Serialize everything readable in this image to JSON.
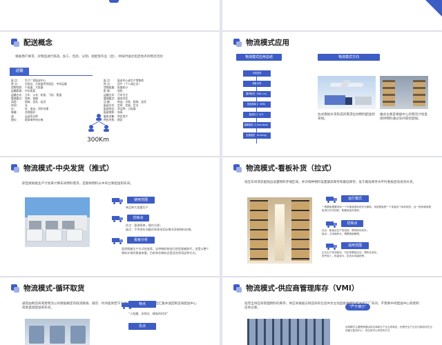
{
  "colors": {
    "accent": "#3d5cc4",
    "accent_light": "#9fb0e6",
    "bg": "#e4e7ee"
  },
  "s1": {
    "title": "配送概念",
    "intro": "根据用户要求，对物品进行拣选、加工、包装、分割、组配等作业（后），并按时送达指定地点的物流活动",
    "label": "运输",
    "rows_left": [
      [
        "起 点：",
        "生产厂家配送中心"
      ],
      [
        "终 点：",
        "分网点、大批量供货园区、中间运输"
      ],
      [
        "货物性质：",
        "少批量、大批量"
      ],
      [
        "运输距离：",
        "中长距离"
      ],
      [
        "运输方式：",
        "大车、火车、轮船、飞机、管道"
      ],
      [
        "管理要点：",
        "简单、快捷"
      ],
      [
        "风险：",
        "损耗、丢失、延迟"
      ],
      [
        "时间：",
        "长"
      ],
      [
        "分：",
        "优、变动，同步处理"
      ],
      [
        "装载：",
        "合理组织"
      ],
      [
        "送：",
        "运送多品种"
      ],
      [
        "提价：",
        "提高每件的价格"
      ]
    ],
    "rows_right": [
      [
        "起 点：",
        "配送中心或生产零售商"
      ],
      [
        "终 点：",
        "用户（个人或企业）"
      ],
      [
        "货物批量：",
        "批量较小"
      ],
      [
        "距 离：",
        "较短"
      ],
      [
        "运输方式：",
        "汽车为主"
      ],
      [
        "管理要点：",
        "服务优先"
      ],
      [
        "功 能：",
        "拣选、分拣、配装、送货"
      ],
      [
        "配送方式：",
        "定时、定量、定点"
      ],
      [
        "配送特点：",
        "多品种、小批量"
      ],
      [
        "配送频率：",
        "较高"
      ],
      [
        "服务对象：",
        "特定用户"
      ],
      [
        "供应关系：",
        "稳定"
      ]
    ],
    "distance": "300Km",
    "people_icon": "people-network-icon"
  },
  "s2": {
    "title": "物流模式应用",
    "tab1": "物流模式应用总结",
    "tab2": "物流模式方向",
    "flow": [
      "中央发货",
      "看板补货",
      "循环取货（Milk run）",
      "供应商库存（VMI）",
      "直送补货（JIT）",
      "越库配送（Cross-dock）",
      "定量配送（Arriving）"
    ],
    "cap1": "拉式看板补货形成的需求拉动物料配送到货线。",
    "cap2": "推式主要是根据中心的物流计划直接将物料通过车间或装配线。"
  },
  "s3": {
    "title": "物流模式-中央发货（推式）",
    "intro": "即直接根据生产计划来计算车间物料需求，定期将物料从中央仓库配送到车间。",
    "tag1": "使用范围",
    "t1": "单品种大批量生产",
    "tag2": "优缺点",
    "t2": "优点：管理简单，操作方便；\n缺点：不考虑车间缓存和现场实际情况导致物料存储。",
    "tag3": "看板分析",
    "t3": "虽然随着生产方式的变革，这种物料物流已经逐渐被取代，但是从整个物料计划的角度来看，目前有些物料还是适合采用这种方式。"
  },
  "s4": {
    "title": "物流模式-看板补货（拉式）",
    "intro": "指在车间或装配线边设置物料存储区域，并对每种物料设置最高库存和最低库存，低于最低库存水平时看板启动发货补货。",
    "tag1": "运行模式",
    "t1": "一般看板需要采用一个平衡制造系统作为基础，传统看板是一个或者多个库存相关，且一般地使用看板进行补货控制，配套相连的库房，",
    "tag2": "优缺点",
    "t2": "优点：能保证生产的连续，降低库存成本；\n缺点：占用面积大，需要精细管理。",
    "tag3": "适用范围",
    "t3": "企业生产线流程化，可实现看板拉动，物料标准化；\n型号较少，批量较大，如流水线装配等。"
  },
  "s5": {
    "title": "物流模式-循环取货",
    "intro": "通常由制造商或者物流公司根据确定的取货路线、顺次、时间驱到若干个供应商处依次取货，最后汇集并送回制造商配送中心或者直接配送到车间。",
    "tag1": "特点",
    "t1": "“小批量、多频次、精准的时间”",
    "tag2": "优点"
  },
  "s6": {
    "title": "物流模式-供应商管理库存（VMI）",
    "intro": "指完全供应商管理物料的库存，供应商根据与制造商的信息共享主动直接将物料配送到工厂车间，不需要中间配送中心或者制造商仓库。",
    "bubble": "“严于律己”",
    "t1": "这种模式主要是根据由供应商和生产企业来制定，但是在生产企业内部如何在当地建立配送中心，供应商可以有效的方式"
  }
}
